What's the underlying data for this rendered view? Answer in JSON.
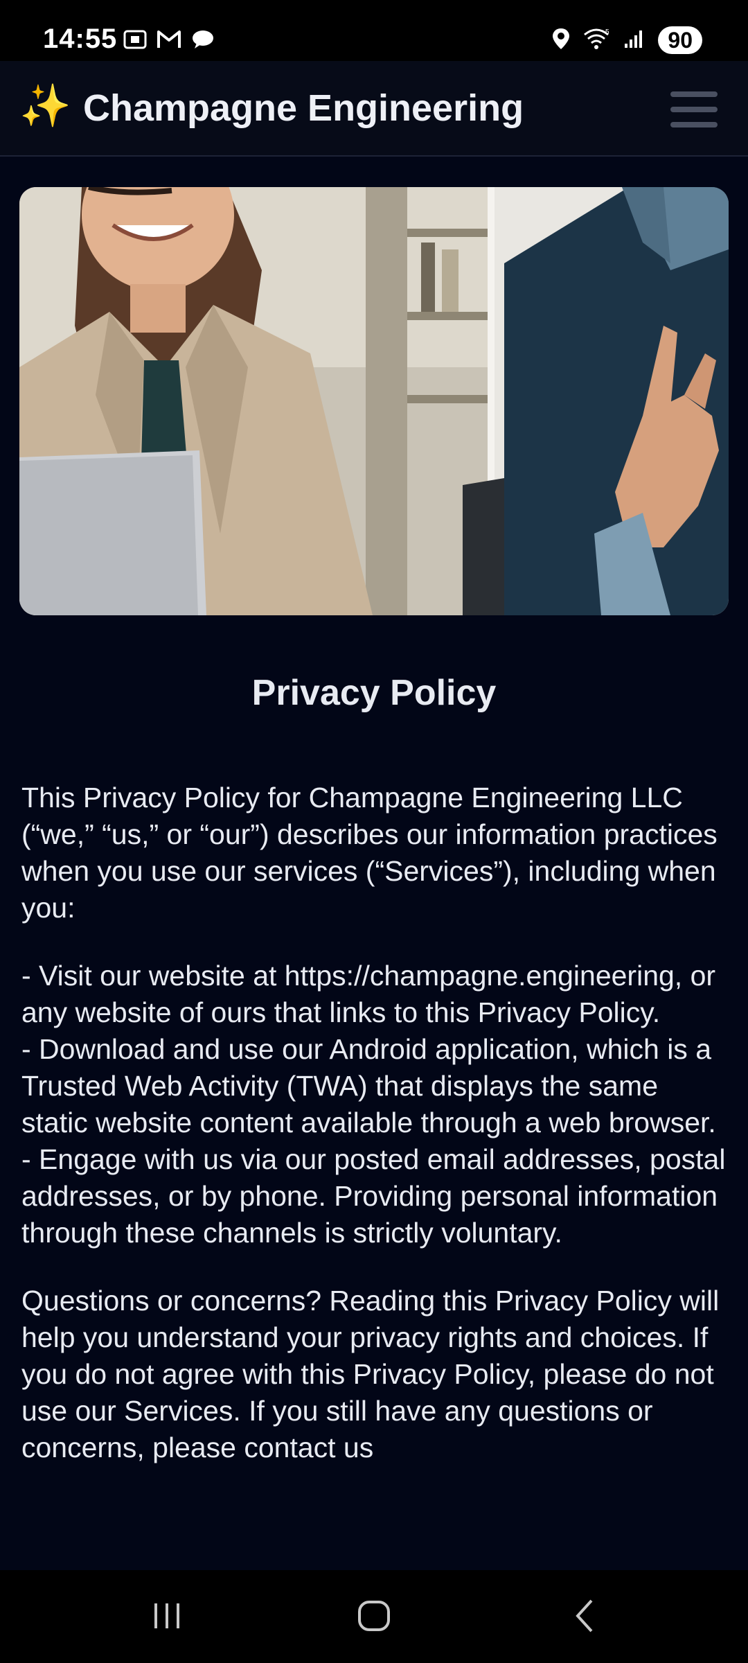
{
  "status_bar": {
    "time": "14:55",
    "battery": "90",
    "icons": [
      "screenshot-icon",
      "gmail-icon",
      "chat-icon",
      "location-icon",
      "wifi-icon",
      "signal-icon"
    ]
  },
  "header": {
    "brand_icon": "✨",
    "title": "Champagne Engineering",
    "menu_icon": "hamburger-menu-icon"
  },
  "hero": {
    "image": "office-meeting-photo"
  },
  "page": {
    "title": "Privacy Policy",
    "intro": "This Privacy Policy for Champagne Engineering LLC (“we,” “us,” or “our”) describes our information practices when you use our services (“Services”), including when you:",
    "bullet_1": "- Visit our website at https://champagne.engineering, or any website of ours that links to this Privacy Policy.",
    "bullet_2": "- Download and use our Android application, which is a Trusted Web Activity (TWA) that displays the same static website content available through a web browser.",
    "bullet_3": "- Engage with us via our posted email addresses, postal addresses, or by phone. Providing personal information through these channels is strictly voluntary.",
    "questions": "Questions or concerns? Reading this Privacy Policy will help you understand your privacy rights and choices. If you do not agree with this Privacy Policy, please do not use our Services. If you still have any questions or concerns, please contact us"
  },
  "nav_bar": {
    "recents": "recents-icon",
    "home": "home-icon",
    "back": "back-icon"
  },
  "colors": {
    "background": "#020617",
    "header": "#070b18",
    "text": "#e8ebf2",
    "accent": "#f5c542"
  }
}
